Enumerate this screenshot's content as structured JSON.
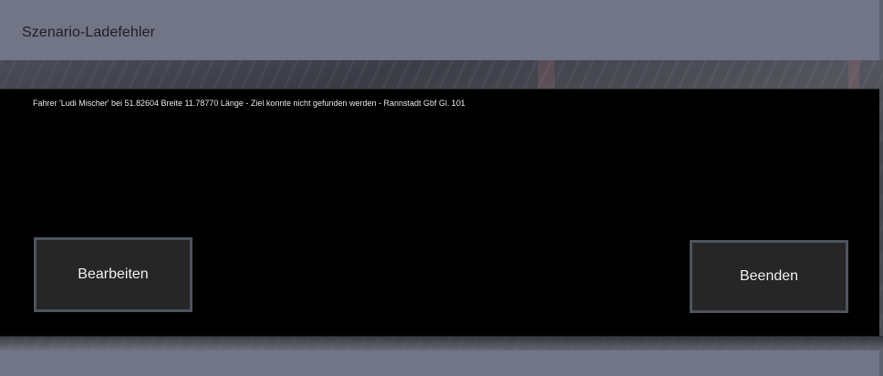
{
  "dialog": {
    "title": "Szenario-Ladefehler",
    "message": "Fahrer 'Ludi Mischer' bei 51.82604 Breite 11.78770 Länge - Ziel konnte nicht gefunden werden - Rannstadt Gbf Gl. 101",
    "edit_label": "Bearbeiten",
    "quit_label": "Beenden"
  },
  "colors": {
    "title_bar": "#717586",
    "panel": "#000000",
    "button_bg": "#262626",
    "button_border": "#4f535d",
    "text_light": "#f0f0f0"
  }
}
